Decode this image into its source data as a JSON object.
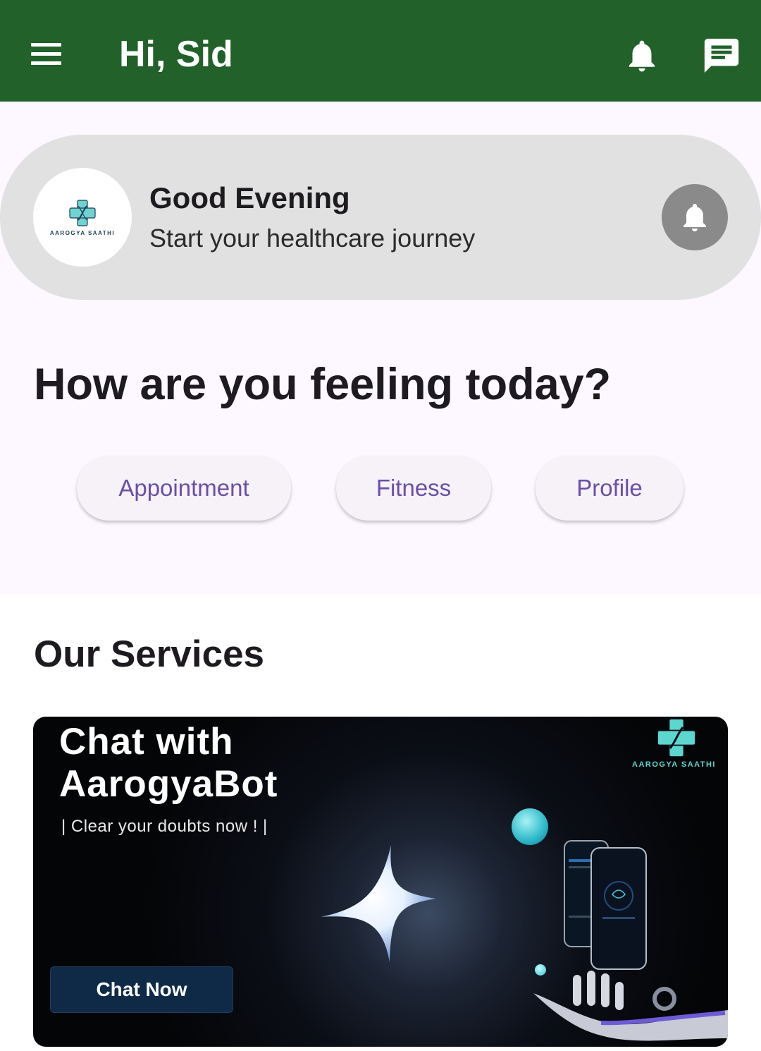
{
  "header": {
    "title": "Hi, Sid",
    "icons": [
      "menu-icon",
      "bell-icon",
      "chat-icon"
    ]
  },
  "greeting": {
    "title": "Good Evening",
    "subtitle": "Start your healthcare journey",
    "logo_text": "AAROGYA SAATHI",
    "icon": "bell-icon"
  },
  "feeling": {
    "heading": "How are you feeling today?",
    "chips": [
      {
        "label": "Appointment"
      },
      {
        "label": "Fitness"
      },
      {
        "label": "Profile"
      }
    ]
  },
  "services": {
    "heading": "Our Services",
    "banner": {
      "title_line1": "Chat with",
      "title_line2": "AarogyaBot",
      "subtitle": "| Clear your doubts now ! |",
      "logo_text": "AAROGYA SAATHI",
      "button_label": "Chat Now"
    }
  },
  "colors": {
    "appbar": "#22612a",
    "chip_text": "#6a4fa6",
    "background_top": "#fdf7ff",
    "greeting_card": "#e1e1e1"
  }
}
